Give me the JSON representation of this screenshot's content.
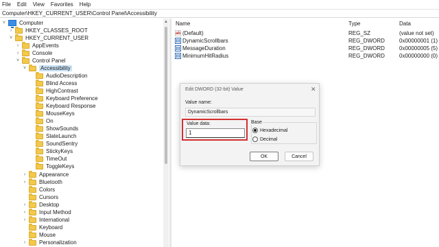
{
  "menu": [
    "File",
    "Edit",
    "View",
    "Favorites",
    "Help"
  ],
  "address": "Computer\\HKEY_CURRENT_USER\\Control Panel\\Accessibility",
  "tree": {
    "computer": "Computer",
    "hkcr": "HKEY_CLASSES_ROOT",
    "hkcu": "HKEY_CURRENT_USER",
    "appevents": "AppEvents",
    "console": "Console",
    "control_panel": "Control Panel",
    "accessibility": "Accessibility",
    "acc_children": [
      "AudioDescription",
      "Blind Access",
      "HighContrast",
      "Keyboard Preference",
      "Keyboard Response",
      "MouseKeys",
      "On",
      "ShowSounds",
      "SlateLaunch",
      "SoundSentry",
      "StickyKeys",
      "TimeOut",
      "ToggleKeys"
    ],
    "cp_children": [
      "Appearance",
      "Bluetooth",
      "Colors",
      "Cursors",
      "Desktop",
      "Input Method",
      "International",
      "Keyboard",
      "Mouse",
      "Personalization"
    ]
  },
  "list": {
    "headers": {
      "name": "Name",
      "type": "Type",
      "data": "Data"
    },
    "rows": [
      {
        "name": "(Default)",
        "type": "REG_SZ",
        "data": "(value not set)",
        "icon": "string-value-icon"
      },
      {
        "name": "DynamicScrollbars",
        "type": "REG_DWORD",
        "data": "0x00000001 (1)",
        "icon": "dword-value-icon"
      },
      {
        "name": "MessageDuration",
        "type": "REG_DWORD",
        "data": "0x00000005 (5)",
        "icon": "dword-value-icon"
      },
      {
        "name": "MinimumHitRadius",
        "type": "REG_DWORD",
        "data": "0x00000000 (0)",
        "icon": "dword-value-icon"
      }
    ]
  },
  "dialog": {
    "title": "Edit DWORD (32-bit) Value",
    "close": "✕",
    "value_name_label": "Value name:",
    "value_name": "DynamicScrollbars",
    "value_data_label": "Value data:",
    "value_data": "1",
    "base_label": "Base",
    "hex_label": "Hexadecimal",
    "dec_label": "Decimal",
    "base_selected": "Hexadecimal",
    "ok": "OK",
    "cancel": "Cancel",
    "highlight_color": "#d32f2f"
  }
}
